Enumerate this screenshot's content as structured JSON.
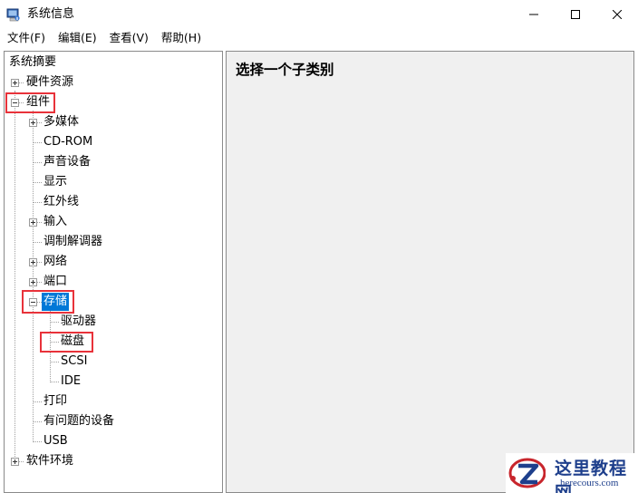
{
  "window": {
    "title": "系统信息",
    "icon": "system-info-icon",
    "controls": [
      "minimize-icon",
      "maximize-icon",
      "close-icon"
    ]
  },
  "menu": [
    {
      "label": "文件(F)"
    },
    {
      "label": "编辑(E)"
    },
    {
      "label": "查看(V)"
    },
    {
      "label": "帮助(H)"
    }
  ],
  "tree": {
    "root": "系统摘要",
    "hardware": "硬件资源",
    "components": "组件",
    "multimedia": "多媒体",
    "cdrom": "CD-ROM",
    "sound": "声音设备",
    "display": "显示",
    "infrared": "红外线",
    "input": "输入",
    "modem": "调制解调器",
    "network": "网络",
    "ports": "端口",
    "storage": "存储",
    "drives": "驱动器",
    "disks": "磁盘",
    "scsi": "SCSI",
    "ide": "IDE",
    "printing": "打印",
    "problem_devices": "有问题的设备",
    "usb": "USB",
    "software": "软件环境",
    "selected": "存储"
  },
  "detail": {
    "heading": "选择一个子类别"
  },
  "highlight_color": "#e8323a",
  "selection_color": "#0078d7",
  "watermark": {
    "name": "这里教程网",
    "site": "herecours.com"
  }
}
